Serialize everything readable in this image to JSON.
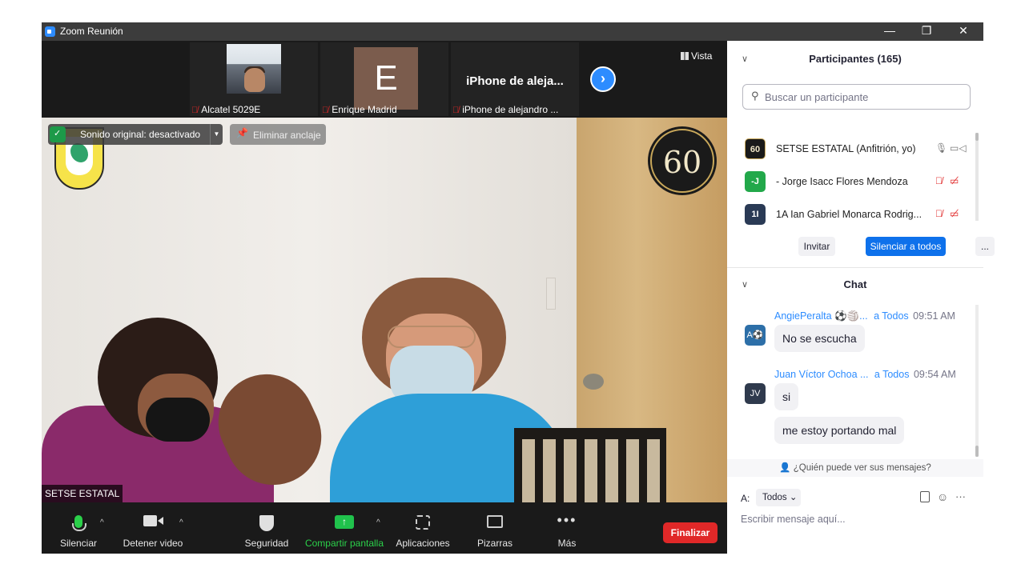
{
  "window": {
    "title": "Zoom Reunión",
    "controls": {
      "minimize": "—",
      "restore": "❐",
      "close": "✕"
    }
  },
  "thumbnails": [
    {
      "name": "Alcatel 5029E",
      "type": "video"
    },
    {
      "name": "Enrique Madrid",
      "type": "avatar",
      "initial": "E",
      "avatar_color": "#7b5c4d"
    },
    {
      "name": "iPhone de alejandro ...",
      "type": "text",
      "display": "iPhone de aleja..."
    }
  ],
  "view_button": {
    "label": "Vista"
  },
  "main_feed": {
    "audio_pill": {
      "label": "Sonido original: desactivado"
    },
    "unpin": {
      "label": "Eliminar anclaje"
    },
    "speaker": "SETSE ESTATAL",
    "logo_60": "60"
  },
  "toolbar": {
    "mute": "Silenciar",
    "video": "Detener video",
    "security": "Seguridad",
    "share": "Compartir pantalla",
    "apps": "Aplicaciones",
    "whiteboard": "Pizarras",
    "more": "Más",
    "end": "Finalizar"
  },
  "participants": {
    "header": "Participantes (165)",
    "search_placeholder": "Buscar un participante",
    "rows": [
      {
        "avatar": "60",
        "avatar_color": "#1a1a1a",
        "name": "SETSE ESTATAL (Anfitrión, yo)",
        "muted": false
      },
      {
        "avatar": "-J",
        "avatar_color": "#22a84a",
        "name": "- Jorge Isacc Flores Mendoza",
        "muted": true
      },
      {
        "avatar": "1I",
        "avatar_color": "#2a3a55",
        "name": "1A Ian Gabriel Monarca Rodrig...",
        "muted": true
      }
    ],
    "invite": "Invitar",
    "mute_all": "Silenciar a todos",
    "more": "..."
  },
  "chat": {
    "header": "Chat",
    "messages": [
      {
        "sender": "AngiePeralta ⚽🏐...",
        "to": "a Todos",
        "time": "09:51 AM",
        "avatar": "A⚽",
        "avatar_color": "#2d6fa8",
        "texts": [
          "No se escucha"
        ]
      },
      {
        "sender": "Juan Víctor Ochoa ...",
        "to": "a Todos",
        "time": "09:54 AM",
        "avatar": "JV",
        "avatar_color": "#2f3a4d",
        "texts": [
          "si",
          "me estoy portando mal"
        ]
      }
    ],
    "who_sees": "¿Quién puede ver sus mensajes?",
    "to_label": "A:",
    "to_value": "Todos",
    "input_placeholder": "Escribir mensaje aquí..."
  }
}
